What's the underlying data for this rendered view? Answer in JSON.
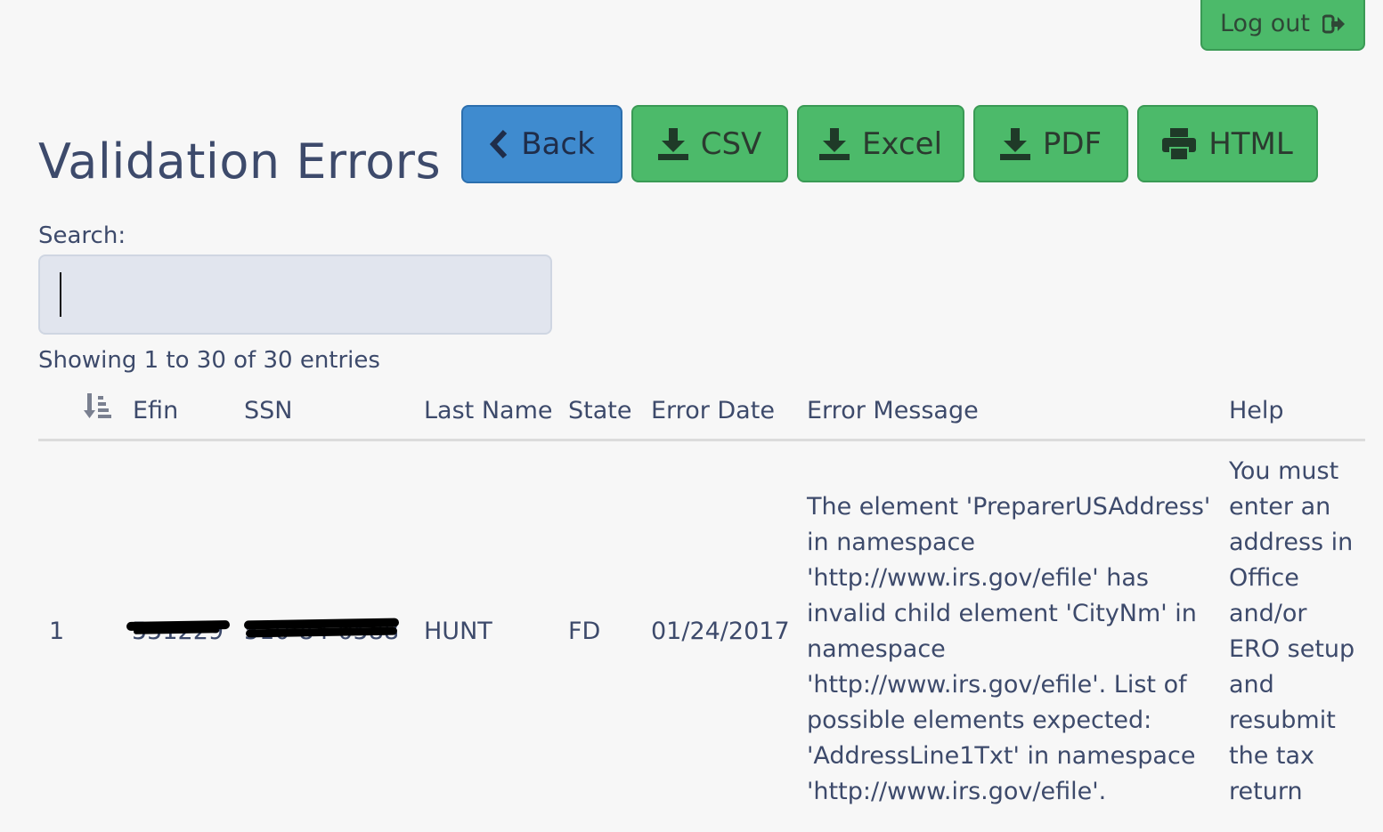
{
  "header": {
    "logout_label": "Log out",
    "title": "Validation Errors"
  },
  "toolbar": {
    "back_label": "Back",
    "csv_label": "CSV",
    "excel_label": "Excel",
    "pdf_label": "PDF",
    "html_label": "HTML"
  },
  "search": {
    "label": "Search:",
    "value": "",
    "placeholder": ""
  },
  "table": {
    "info": "Showing 1 to 30 of 30 entries",
    "columns": [
      "Efin",
      "SSN",
      "Last Name",
      "State",
      "Error Date",
      "Error Message",
      "Help"
    ],
    "rows": [
      {
        "index": "1",
        "efin": "551229",
        "ssn": "510-84-0588",
        "last_name": "HUNT",
        "state": "FD",
        "error_date": "01/24/2017",
        "error_message": "The element 'PreparerUSAddress' in namespace 'http://www.irs.gov/efile' has invalid child element 'CityNm' in namespace 'http://www.irs.gov/efile'. List of possible elements expected: 'AddressLine1Txt' in namespace 'http://www.irs.gov/efile'.",
        "help": "You must enter an address in Office and/or ERO setup and resubmit the tax return"
      }
    ]
  },
  "colors": {
    "green": "#4cba6a",
    "blue": "#3f8bcf",
    "text": "#3d4a6b",
    "background": "#f7f7f7"
  },
  "icons": [
    "logout-icon",
    "chevron-left-icon",
    "download-icon",
    "print-icon",
    "sort-icon"
  ]
}
